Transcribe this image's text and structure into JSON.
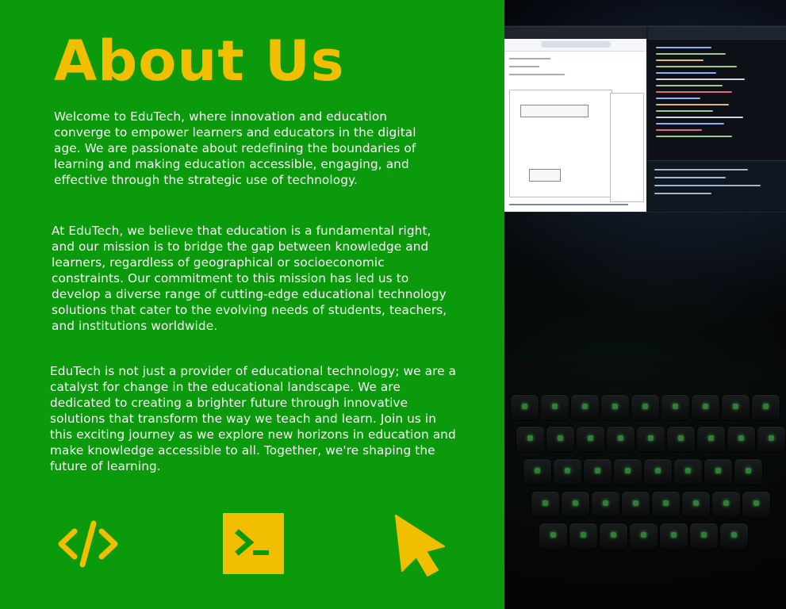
{
  "page": {
    "title": "About Us",
    "paragraphs": [
      "Welcome to EduTech, where innovation and education converge to empower learners and educators in the digital age. We are passionate about redefining the boundaries of learning and making education accessible, engaging, and effective through the strategic use of technology.",
      "At EduTech, we believe that education is a fundamental right, and our mission is to bridge the gap between knowledge and learners, regardless of geographical or socioeconomic constraints. Our commitment to this mission has led us to develop a diverse range of cutting-edge educational technology solutions that cater to the evolving needs of students, teachers, and institutions worldwide.",
      "EduTech is not just a provider of educational technology; we are a catalyst for change in the educational landscape. We are dedicated to creating a brighter future through innovative solutions that transform the way we teach and learn. Join us in this exciting journey as we explore new horizons in education and make knowledge accessible to all. Together, we're shaping the future of learning."
    ]
  },
  "colors": {
    "background": "#0b9a0b",
    "accent": "#f2bf00",
    "text": "#f8f8f8",
    "photo_dark": "#030404",
    "keyboard_glow": "#56ff60"
  },
  "icons": [
    {
      "name": "code-icon"
    },
    {
      "name": "terminal-icon"
    },
    {
      "name": "cursor-icon"
    }
  ],
  "photo": {
    "name": "laptop-coding-photo"
  }
}
